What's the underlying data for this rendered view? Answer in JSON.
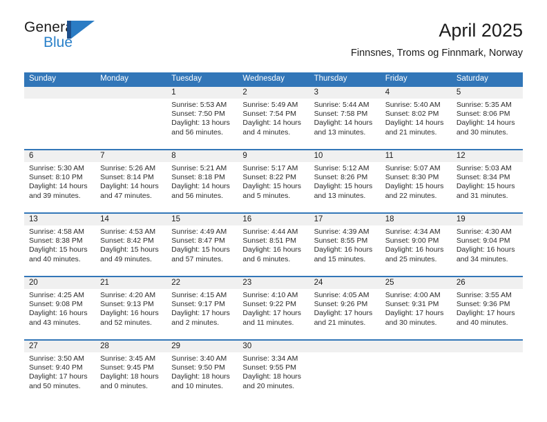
{
  "brand": {
    "word_general": "General",
    "word_blue": "Blue",
    "logo_bar_color": "#1d4f8c",
    "logo_triangle_color": "#2b7cc4",
    "blue_text_color": "#2980c9"
  },
  "header": {
    "title": "April 2025",
    "subtitle": "Finnsnes, Troms og Finnmark, Norway",
    "accent_color": "#3276b8",
    "daynum_strip_color": "#f0f0f0"
  },
  "weekdays": [
    "Sunday",
    "Monday",
    "Tuesday",
    "Wednesday",
    "Thursday",
    "Friday",
    "Saturday"
  ],
  "weeks": [
    {
      "days": [
        {
          "num": "",
          "empty": true
        },
        {
          "num": "",
          "empty": true
        },
        {
          "num": "1",
          "sunrise": "Sunrise: 5:53 AM",
          "sunset": "Sunset: 7:50 PM",
          "daylight_a": "Daylight: 13 hours",
          "daylight_b": "and 56 minutes."
        },
        {
          "num": "2",
          "sunrise": "Sunrise: 5:49 AM",
          "sunset": "Sunset: 7:54 PM",
          "daylight_a": "Daylight: 14 hours",
          "daylight_b": "and 4 minutes."
        },
        {
          "num": "3",
          "sunrise": "Sunrise: 5:44 AM",
          "sunset": "Sunset: 7:58 PM",
          "daylight_a": "Daylight: 14 hours",
          "daylight_b": "and 13 minutes."
        },
        {
          "num": "4",
          "sunrise": "Sunrise: 5:40 AM",
          "sunset": "Sunset: 8:02 PM",
          "daylight_a": "Daylight: 14 hours",
          "daylight_b": "and 21 minutes."
        },
        {
          "num": "5",
          "sunrise": "Sunrise: 5:35 AM",
          "sunset": "Sunset: 8:06 PM",
          "daylight_a": "Daylight: 14 hours",
          "daylight_b": "and 30 minutes."
        }
      ]
    },
    {
      "days": [
        {
          "num": "6",
          "sunrise": "Sunrise: 5:30 AM",
          "sunset": "Sunset: 8:10 PM",
          "daylight_a": "Daylight: 14 hours",
          "daylight_b": "and 39 minutes."
        },
        {
          "num": "7",
          "sunrise": "Sunrise: 5:26 AM",
          "sunset": "Sunset: 8:14 PM",
          "daylight_a": "Daylight: 14 hours",
          "daylight_b": "and 47 minutes."
        },
        {
          "num": "8",
          "sunrise": "Sunrise: 5:21 AM",
          "sunset": "Sunset: 8:18 PM",
          "daylight_a": "Daylight: 14 hours",
          "daylight_b": "and 56 minutes."
        },
        {
          "num": "9",
          "sunrise": "Sunrise: 5:17 AM",
          "sunset": "Sunset: 8:22 PM",
          "daylight_a": "Daylight: 15 hours",
          "daylight_b": "and 5 minutes."
        },
        {
          "num": "10",
          "sunrise": "Sunrise: 5:12 AM",
          "sunset": "Sunset: 8:26 PM",
          "daylight_a": "Daylight: 15 hours",
          "daylight_b": "and 13 minutes."
        },
        {
          "num": "11",
          "sunrise": "Sunrise: 5:07 AM",
          "sunset": "Sunset: 8:30 PM",
          "daylight_a": "Daylight: 15 hours",
          "daylight_b": "and 22 minutes."
        },
        {
          "num": "12",
          "sunrise": "Sunrise: 5:03 AM",
          "sunset": "Sunset: 8:34 PM",
          "daylight_a": "Daylight: 15 hours",
          "daylight_b": "and 31 minutes."
        }
      ]
    },
    {
      "days": [
        {
          "num": "13",
          "sunrise": "Sunrise: 4:58 AM",
          "sunset": "Sunset: 8:38 PM",
          "daylight_a": "Daylight: 15 hours",
          "daylight_b": "and 40 minutes."
        },
        {
          "num": "14",
          "sunrise": "Sunrise: 4:53 AM",
          "sunset": "Sunset: 8:42 PM",
          "daylight_a": "Daylight: 15 hours",
          "daylight_b": "and 49 minutes."
        },
        {
          "num": "15",
          "sunrise": "Sunrise: 4:49 AM",
          "sunset": "Sunset: 8:47 PM",
          "daylight_a": "Daylight: 15 hours",
          "daylight_b": "and 57 minutes."
        },
        {
          "num": "16",
          "sunrise": "Sunrise: 4:44 AM",
          "sunset": "Sunset: 8:51 PM",
          "daylight_a": "Daylight: 16 hours",
          "daylight_b": "and 6 minutes."
        },
        {
          "num": "17",
          "sunrise": "Sunrise: 4:39 AM",
          "sunset": "Sunset: 8:55 PM",
          "daylight_a": "Daylight: 16 hours",
          "daylight_b": "and 15 minutes."
        },
        {
          "num": "18",
          "sunrise": "Sunrise: 4:34 AM",
          "sunset": "Sunset: 9:00 PM",
          "daylight_a": "Daylight: 16 hours",
          "daylight_b": "and 25 minutes."
        },
        {
          "num": "19",
          "sunrise": "Sunrise: 4:30 AM",
          "sunset": "Sunset: 9:04 PM",
          "daylight_a": "Daylight: 16 hours",
          "daylight_b": "and 34 minutes."
        }
      ]
    },
    {
      "days": [
        {
          "num": "20",
          "sunrise": "Sunrise: 4:25 AM",
          "sunset": "Sunset: 9:08 PM",
          "daylight_a": "Daylight: 16 hours",
          "daylight_b": "and 43 minutes."
        },
        {
          "num": "21",
          "sunrise": "Sunrise: 4:20 AM",
          "sunset": "Sunset: 9:13 PM",
          "daylight_a": "Daylight: 16 hours",
          "daylight_b": "and 52 minutes."
        },
        {
          "num": "22",
          "sunrise": "Sunrise: 4:15 AM",
          "sunset": "Sunset: 9:17 PM",
          "daylight_a": "Daylight: 17 hours",
          "daylight_b": "and 2 minutes."
        },
        {
          "num": "23",
          "sunrise": "Sunrise: 4:10 AM",
          "sunset": "Sunset: 9:22 PM",
          "daylight_a": "Daylight: 17 hours",
          "daylight_b": "and 11 minutes."
        },
        {
          "num": "24",
          "sunrise": "Sunrise: 4:05 AM",
          "sunset": "Sunset: 9:26 PM",
          "daylight_a": "Daylight: 17 hours",
          "daylight_b": "and 21 minutes."
        },
        {
          "num": "25",
          "sunrise": "Sunrise: 4:00 AM",
          "sunset": "Sunset: 9:31 PM",
          "daylight_a": "Daylight: 17 hours",
          "daylight_b": "and 30 minutes."
        },
        {
          "num": "26",
          "sunrise": "Sunrise: 3:55 AM",
          "sunset": "Sunset: 9:36 PM",
          "daylight_a": "Daylight: 17 hours",
          "daylight_b": "and 40 minutes."
        }
      ]
    },
    {
      "days": [
        {
          "num": "27",
          "sunrise": "Sunrise: 3:50 AM",
          "sunset": "Sunset: 9:40 PM",
          "daylight_a": "Daylight: 17 hours",
          "daylight_b": "and 50 minutes."
        },
        {
          "num": "28",
          "sunrise": "Sunrise: 3:45 AM",
          "sunset": "Sunset: 9:45 PM",
          "daylight_a": "Daylight: 18 hours",
          "daylight_b": "and 0 minutes."
        },
        {
          "num": "29",
          "sunrise": "Sunrise: 3:40 AM",
          "sunset": "Sunset: 9:50 PM",
          "daylight_a": "Daylight: 18 hours",
          "daylight_b": "and 10 minutes."
        },
        {
          "num": "30",
          "sunrise": "Sunrise: 3:34 AM",
          "sunset": "Sunset: 9:55 PM",
          "daylight_a": "Daylight: 18 hours",
          "daylight_b": "and 20 minutes."
        },
        {
          "num": "",
          "empty": true
        },
        {
          "num": "",
          "empty": true
        },
        {
          "num": "",
          "empty": true
        }
      ]
    }
  ]
}
